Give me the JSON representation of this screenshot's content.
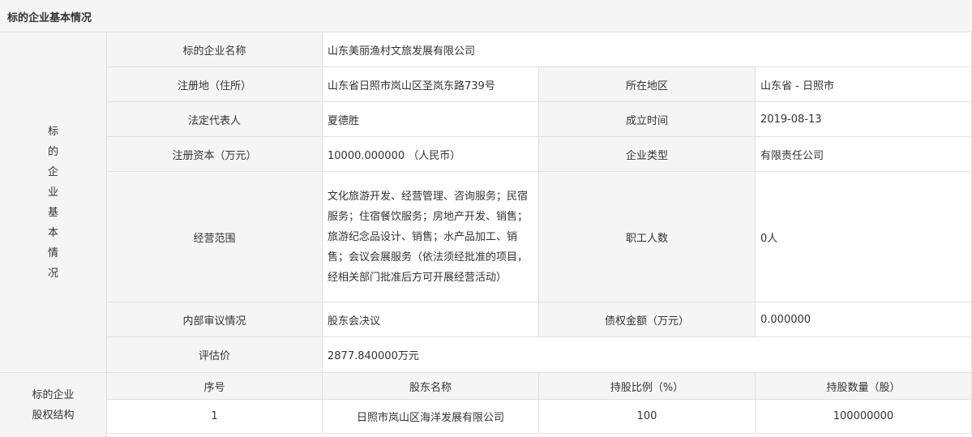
{
  "section_title": "标的企业基本情况",
  "basic": {
    "side_label": "标的企业基本情况",
    "company_name_label": "标的企业名称",
    "company_name": "山东美丽渔村文旅发展有限公司",
    "address_label": "注册地（住所）",
    "address": "山东省日照市岚山区圣岚东路739号",
    "region_label": "所在地区",
    "region": "山东省 - 日照市",
    "legal_rep_label": "法定代表人",
    "legal_rep": "夏德胜",
    "founded_label": "成立时间",
    "founded": "2019-08-13",
    "capital_label": "注册资本（万元）",
    "capital": "10000.000000 （人民币）",
    "type_label": "企业类型",
    "type": "有限责任公司",
    "scope_label": "经营范围",
    "scope": "文化旅游开发、经营管理、咨询服务；民宿服务；住宿餐饮服务；房地产开发、销售；旅游纪念品设计、销售；水产品加工、销售；会议会展服务（依法须经批准的项目，经相关部门批准后方可开展经营活动）",
    "employees_label": "职工人数",
    "employees": "0人",
    "audit_label": "内部审议情况",
    "audit": "股东会决议",
    "debt_label": "债权金额（万元）",
    "debt": "0.000000",
    "valuation_label": "评估价",
    "valuation": "2877.840000万元"
  },
  "equity": {
    "side_label_line1": "标的企业",
    "side_label_line2": "股权结构",
    "headers": [
      "序号",
      "股东名称",
      "持股比例（%）",
      "持股数量（股）"
    ],
    "rows": [
      [
        "1",
        "日照市岚山区海洋发展有限公司",
        "100",
        "100000000"
      ]
    ]
  }
}
